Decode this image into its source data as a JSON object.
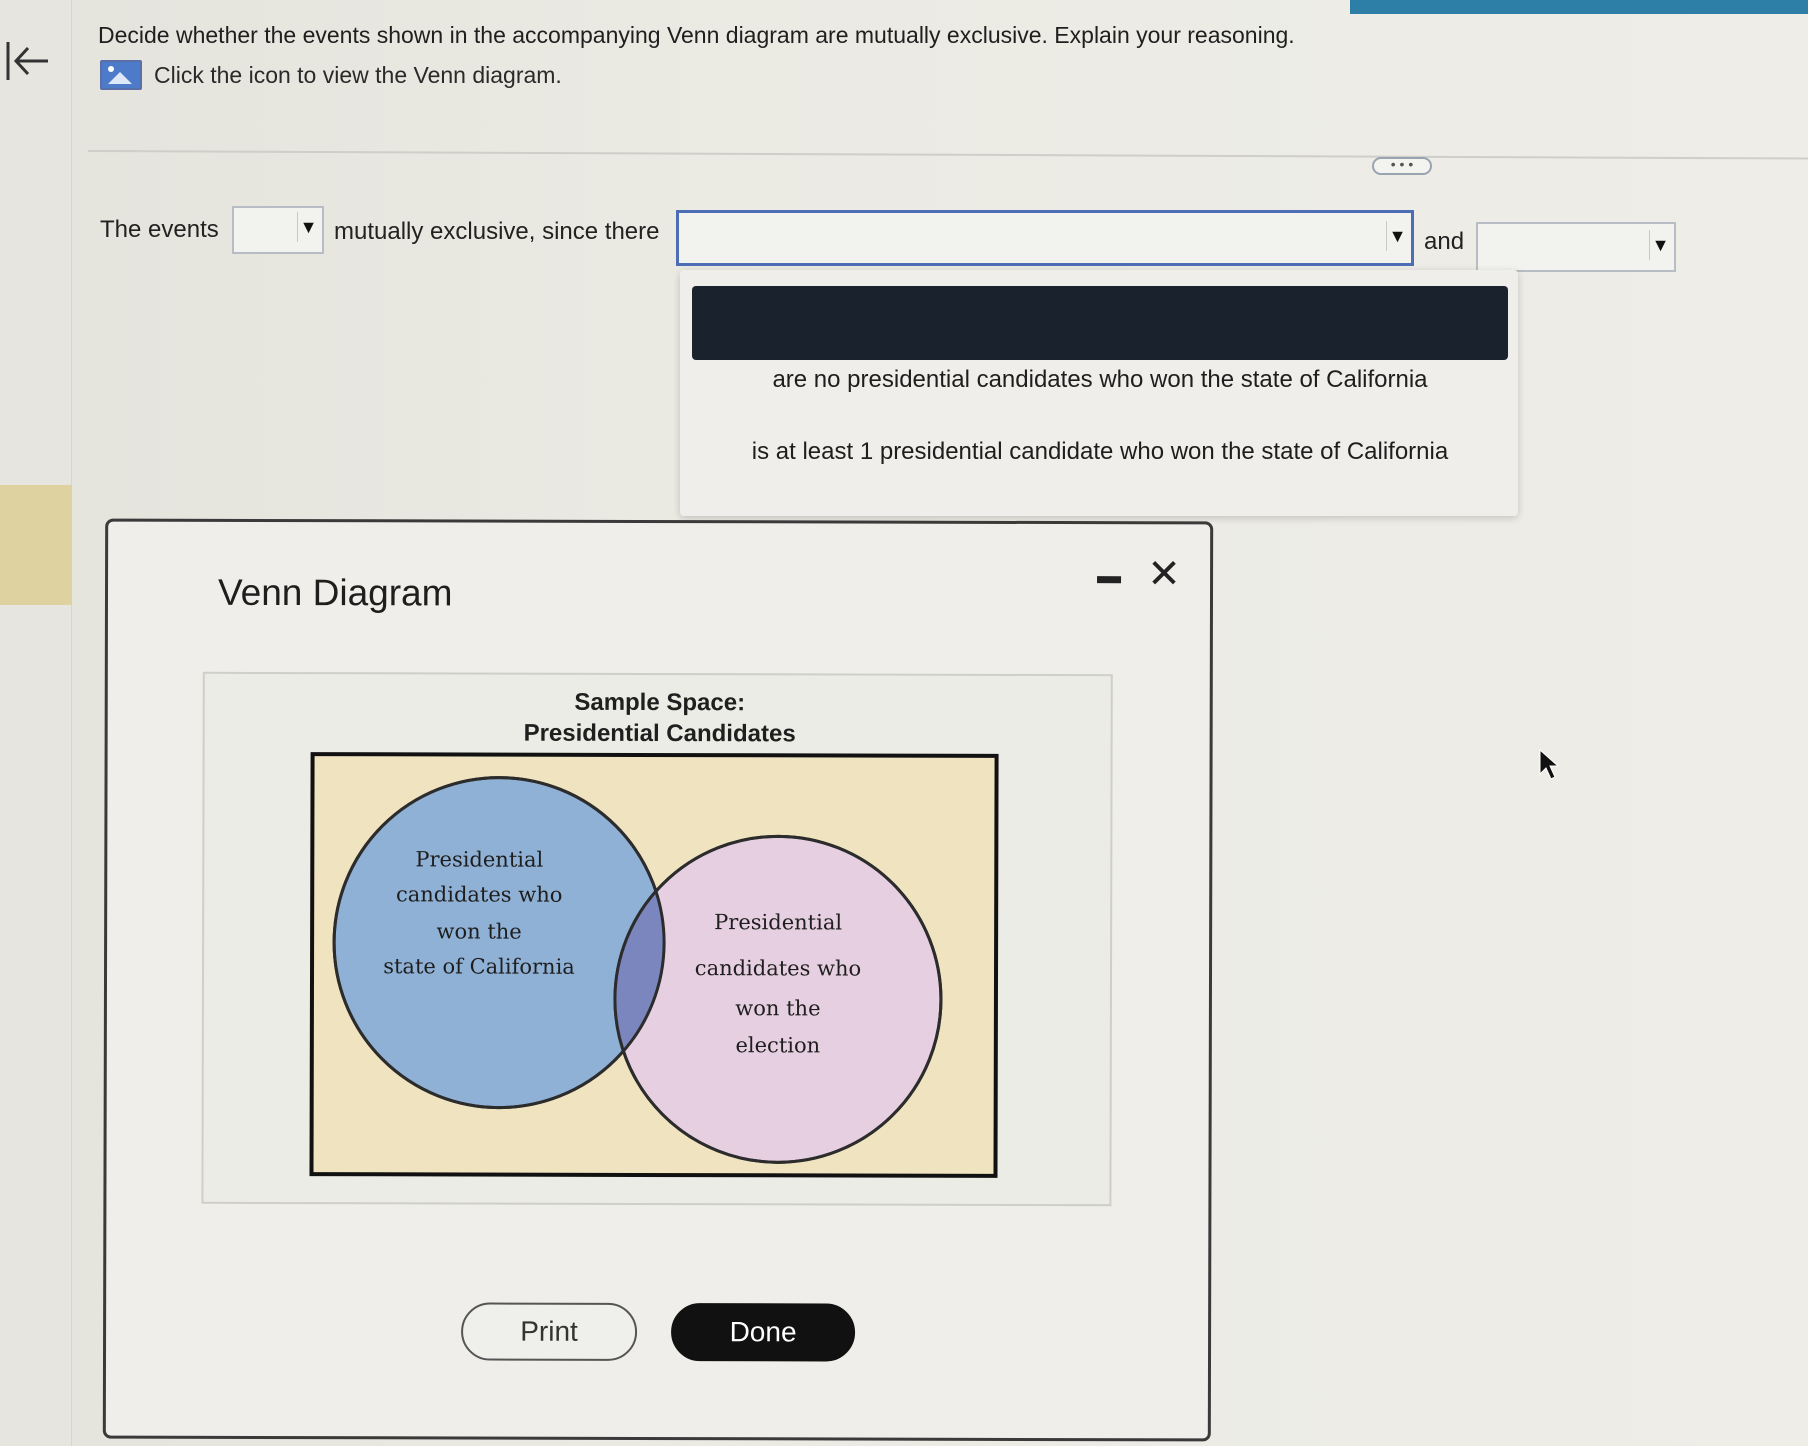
{
  "question": {
    "prompt": "Decide whether the events shown in the accompanying Venn diagram are mutually exclusive. Explain your reasoning.",
    "venn_link": "Click the icon to view the Venn diagram.",
    "more_label": "• • •"
  },
  "answer": {
    "prefix": "The events",
    "middle": "mutually exclusive, since there",
    "conjunction": "and",
    "select1_value": "",
    "select2_value": "",
    "select3_value": ""
  },
  "dropdown": {
    "options": [
      "are no presidential candidates who won the state of California",
      "is at least 1 presidential candidate who won the state of California"
    ]
  },
  "modal": {
    "title": "Venn Diagram",
    "print_label": "Print",
    "done_label": "Done"
  },
  "diagram": {
    "sample_space_line1": "Sample Space:",
    "sample_space_line2": "Presidential Candidates",
    "circle_a": [
      "Presidential",
      "candidates who",
      "won the",
      "state of California"
    ],
    "circle_b": [
      "Presidential",
      "candidates who",
      "won the",
      "election"
    ],
    "colors": {
      "background": "#efe3c0",
      "circle_a": "#8fb1d6",
      "circle_b": "#e6cfe0",
      "overlap": "#7b86bf"
    }
  },
  "icons": {
    "back": "back-arrow-icon",
    "image": "image-icon",
    "close": "close-icon",
    "minimize": "minimize-icon",
    "cursor": "mouse-pointer-icon"
  }
}
